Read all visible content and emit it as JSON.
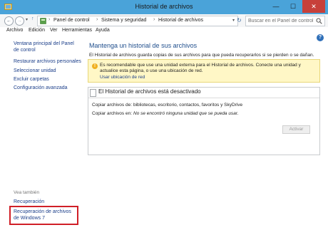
{
  "window": {
    "title": "Historial de archivos"
  },
  "window_controls": {
    "minimize": "—",
    "maximize": "☐",
    "close": "✕"
  },
  "nav": {
    "back_glyph": "←",
    "forward_glyph": "→",
    "history_glyph": "▾",
    "up_glyph": "↑",
    "refresh_glyph": "↻"
  },
  "breadcrumb": {
    "separator": "›",
    "items": [
      "Panel de control",
      "Sistema y seguridad",
      "Historial de archivos"
    ],
    "dropdown_glyph": "▾"
  },
  "search": {
    "placeholder": "Buscar en el Panel de control",
    "value": ""
  },
  "menu": {
    "items": [
      "Archivo",
      "Edición",
      "Ver",
      "Herramientas",
      "Ayuda"
    ]
  },
  "help_glyph": "?",
  "left_pane": {
    "links": [
      "Ventana principal del Panel de control",
      "Restaurar archivos personales",
      "Seleccionar unidad",
      "Excluir carpetas",
      "Configuración avanzada"
    ],
    "see_also_label": "Vea también",
    "see_also_links": [
      "Recuperación",
      "Recuperación de archivos de Windows 7"
    ]
  },
  "main": {
    "title": "Mantenga un historial de sus archivos",
    "description": "El Historial de archivos guarda copias de sus archivos para que pueda recuperarlos si se pierden o se dañan.",
    "notice": {
      "icon_glyph": "!",
      "text": "Es recomendable que use una unidad externa para el Historial de archivos. Conecte una unidad y actualice esta página, o use una ubicación de red.",
      "link": "Usar ubicación de red"
    },
    "status": {
      "heading": "El Historial de archivos está desactivado",
      "rows": [
        {
          "label": "Copiar archivos de:",
          "value": "bibliotecas, escritorio, contactos, favoritos y SkyDrive"
        },
        {
          "label": "Copiar archivos en:",
          "value": "No se encontró ninguna unidad que se pueda usar."
        }
      ]
    },
    "activate_button": "Activar"
  },
  "colors": {
    "titlebar": "#4aa3d9",
    "link": "#1c3f8a",
    "heading": "#1f4e8c",
    "notice_bg": "#fff7c6",
    "highlight_box": "#d01f27"
  }
}
